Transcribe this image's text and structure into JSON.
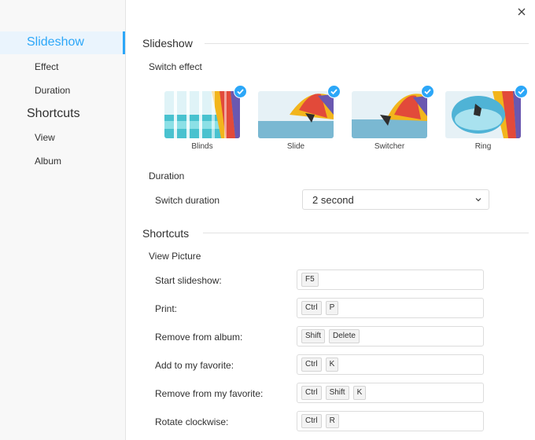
{
  "sidebar": {
    "items": [
      {
        "label": "Slideshow"
      },
      {
        "label": "Effect"
      },
      {
        "label": "Duration"
      },
      {
        "label": "Shortcuts"
      },
      {
        "label": "View"
      },
      {
        "label": "Album"
      }
    ]
  },
  "slideshow": {
    "title": "Slideshow",
    "switch_effect_label": "Switch effect",
    "effects": [
      {
        "label": "Blinds",
        "selected": true
      },
      {
        "label": "Slide",
        "selected": true
      },
      {
        "label": "Switcher",
        "selected": true
      },
      {
        "label": "Ring",
        "selected": true
      }
    ],
    "duration_label": "Duration",
    "switch_duration_label": "Switch duration",
    "switch_duration_value": "2 second"
  },
  "shortcuts": {
    "title": "Shortcuts",
    "view_picture_label": "View Picture",
    "rows": [
      {
        "label": "Start slideshow:",
        "keys": [
          "F5"
        ]
      },
      {
        "label": "Print:",
        "keys": [
          "Ctrl",
          "P"
        ]
      },
      {
        "label": "Remove from album:",
        "keys": [
          "Shift",
          "Delete"
        ]
      },
      {
        "label": "Add to my favorite:",
        "keys": [
          "Ctrl",
          "K"
        ]
      },
      {
        "label": "Remove from my favorite:",
        "keys": [
          "Ctrl",
          "Shift",
          "K"
        ]
      },
      {
        "label": "Rotate clockwise:",
        "keys": [
          "Ctrl",
          "R"
        ]
      }
    ]
  },
  "colors": {
    "accent": "#2ca7f8",
    "sidebar_bg": "#f8f8f8",
    "selected_bg": "#eaf4fd"
  },
  "icons": {
    "close": "close-icon",
    "check": "check-icon",
    "dropdown": "chevron-down-icon"
  }
}
